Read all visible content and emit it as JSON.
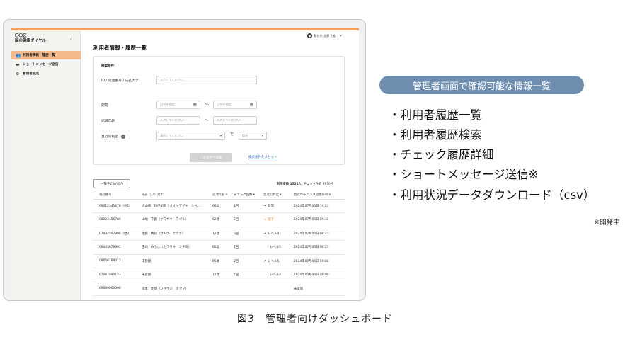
{
  "sidebar": {
    "brand_line1": "〇〇区",
    "brand_line2": "脳の健康ダイヤル",
    "collapse_glyph": "‹",
    "items": [
      {
        "label": "利用者情報・履歴一覧",
        "icon": "users-icon"
      },
      {
        "label": "ショートメッセージ送信",
        "icon": "message-icon"
      },
      {
        "label": "管理者設定",
        "icon": "gear-icon"
      }
    ]
  },
  "header": {
    "user_name": "長谷川 太郎（仮）",
    "page_title": "利用者情報・履歴一覧"
  },
  "search": {
    "title": "検索条件",
    "id_label": "ID / 電話番号 / 氏名カナ",
    "id_placeholder": "入力してください",
    "period_label": "期間",
    "date_placeholder": "日付を指定",
    "age_label": "認識年齢",
    "age_placeholder": "入力してください",
    "judgement_label": "直近の判定",
    "judgement_placeholder": "選択してください",
    "judgement_joiner": "で",
    "level_placeholder": "選択",
    "range_sep": "〜",
    "submit_label": "この条件で検索",
    "reset_label": "検索条件をリセット"
  },
  "results": {
    "csv_label": "一覧をCSV出力",
    "user_count": "利用者数 1521人",
    "check_count": "チェック件数 4670件",
    "columns": [
      "電話番号",
      "氏名（フリガナ）",
      "認識年齢 ▾",
      "チェック回数 ▾",
      "直近の判定 ▾",
      "直近のチェック開始日時 ▾"
    ],
    "rows": [
      {
        "phone": "09012345678（他1）",
        "name": "大山崎　翔伊知郎（オオヤマザキ　ショ…",
        "age": "66歳",
        "checks": "4回",
        "trend": "→",
        "judgement": "健常",
        "date": "2024年07月05日 10:23"
      },
      {
        "phone": "08023456789",
        "name": "山崎　千賀（ヤマザキ　チヅル）",
        "age": "62歳",
        "checks": "2回",
        "trend": "↘",
        "judgement": "低下",
        "date": "2024年07月05日 09:32"
      },
      {
        "phone": "07034567890（他2）",
        "name": "佐藤　秀雄（サトウ　ヒデオ）",
        "age": "72歳",
        "checks": "3回",
        "trend": "→",
        "judgement": "レベル4",
        "date": "2024年07月05日 08:23"
      },
      {
        "phone": "09045678901",
        "name": "田崎　みちよ（カワサキ　ミチヨ）",
        "age": "60歳",
        "checks": "1回",
        "trend": "",
        "judgement": "レベル5",
        "date": "2024年07月05日 08:23"
      },
      {
        "phone": "08056789012",
        "name": "未登録",
        "age": "65歳",
        "checks": "2回",
        "trend": "↗",
        "judgement": "レベル5",
        "date": "2024年00月00日 00:00"
      },
      {
        "phone": "07067890123",
        "name": "未登録",
        "age": "71歳",
        "checks": "1回",
        "trend": "",
        "judgement": "レベル4",
        "date": "2024年00月00日 00:00"
      },
      {
        "phone": "09000000000",
        "name": "岡本　丈翔（ショウジ　タクマ）",
        "age": "",
        "checks": "",
        "trend": "",
        "judgement": "",
        "date": "未実施"
      }
    ]
  },
  "panel": {
    "title": "管理者画面で確認可能な情報一覧",
    "features": [
      "・利用者履歴一覧",
      "・利用者履歴検索",
      "・チェック履歴詳細",
      "・ショートメッセージ送信※",
      "・利用状況データダウンロード（csv）"
    ],
    "note": "※開発中"
  },
  "caption": "図3　管理者向けダッシュボード",
  "colors": {
    "accent": "#f0a060",
    "active_nav": "#f4b98a",
    "panel": "#6f8eaf",
    "link": "#2b5fb3"
  }
}
